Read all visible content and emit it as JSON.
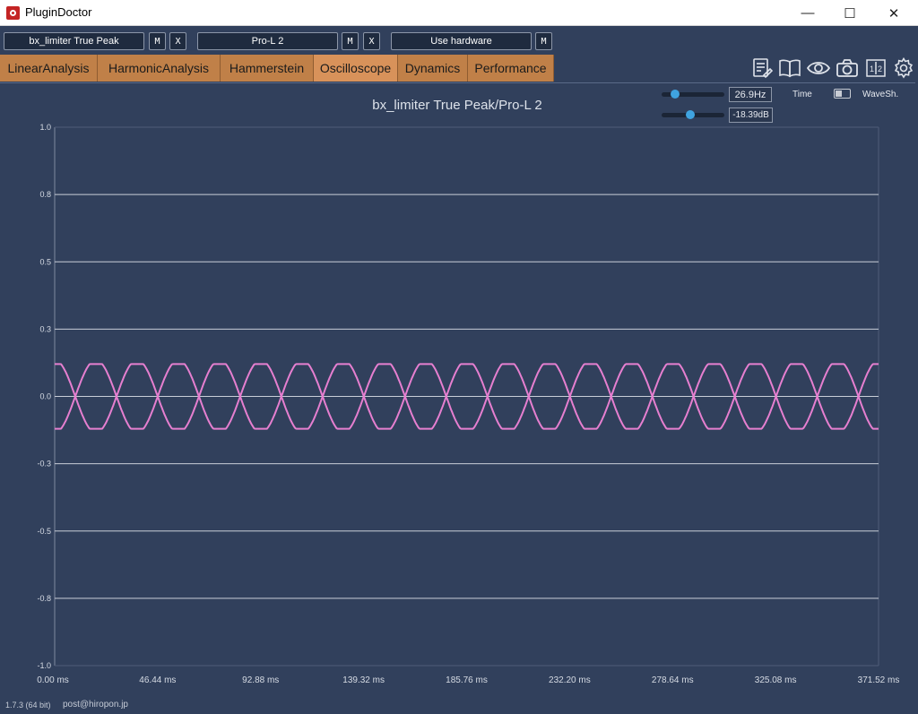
{
  "window": {
    "title": "PluginDoctor",
    "minimize": "—",
    "maximize": "☐",
    "close": "✕"
  },
  "toolbar": {
    "slot1": {
      "label": "bx_limiter True Peak",
      "m": "M",
      "x": "X"
    },
    "slot2": {
      "label": "Pro-L 2",
      "m": "M",
      "x": "X"
    },
    "slot3": {
      "label": "Use hardware",
      "m": "M"
    }
  },
  "tabs": [
    {
      "label": "LinearAnalysis"
    },
    {
      "label": "HarmonicAnalysis"
    },
    {
      "label": "Hammerstein"
    },
    {
      "label": "Oscilloscope"
    },
    {
      "label": "Dynamics"
    },
    {
      "label": "Performance"
    }
  ],
  "active_tab": "Oscilloscope",
  "tool_icons": [
    "notes-icon",
    "book-icon",
    "eye-icon",
    "camera-icon",
    "compare-icon",
    "gear-icon"
  ],
  "controls": {
    "frequency": "26.9Hz",
    "frequency_level": 0.22,
    "level": "-18.39dB",
    "level_level": 0.45,
    "time_label": "Time",
    "waveshaper_label": "WaveSh."
  },
  "footer": {
    "version": "1.7.3 (64 bit)",
    "email": "post@hiropon.jp"
  },
  "colors": {
    "background": "#31405c",
    "tab": "#c08048",
    "tab_active": "#d8925a",
    "trace": "#e67fd0",
    "grid": "#c9ced8"
  },
  "chart_data": {
    "type": "line",
    "title": "bx_limiter True Peak/Pro-L 2",
    "xlabel": "",
    "ylabel": "",
    "xlim": [
      0,
      371.52
    ],
    "ylim": [
      -1.0,
      1.0
    ],
    "x_ticks": [
      "0.00 ms",
      "46.44 ms",
      "92.88 ms",
      "139.32 ms",
      "185.76 ms",
      "232.20 ms",
      "278.64 ms",
      "325.08 ms",
      "371.52 ms"
    ],
    "y_ticks": [
      "1.0",
      "0.8",
      "0.5",
      "0.3",
      "0.0",
      "-0.3",
      "-0.5",
      "-0.8",
      "-1.0"
    ],
    "grid": true,
    "series": [
      {
        "frequency_hz": 26.9,
        "amplitude": 0.12,
        "start_value": 0.12,
        "shape": "clipped-sine",
        "color": "#e67fd0"
      },
      {
        "frequency_hz": 26.9,
        "amplitude": 0.12,
        "start_value": -0.12,
        "shape": "clipped-sine",
        "color": "#e67fd0"
      }
    ]
  }
}
